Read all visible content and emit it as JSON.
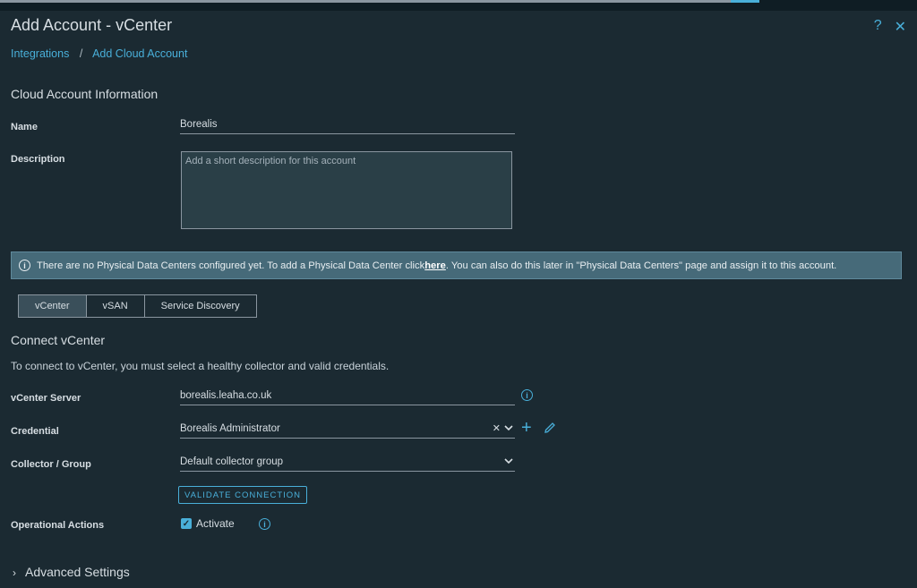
{
  "header": {
    "title": "Add Account - vCenter",
    "help_icon": "?",
    "close_icon": "✕"
  },
  "breadcrumb": {
    "items": [
      "Integrations",
      "Add Cloud Account"
    ],
    "separator": "/"
  },
  "cloud_account": {
    "section_title": "Cloud Account Information",
    "name_label": "Name",
    "name_value": "Borealis",
    "description_label": "Description",
    "description_placeholder": "Add a short description for this account"
  },
  "alert": {
    "text_before": "There are no Physical Data Centers configured yet. To add a Physical Data Center click ",
    "link": "here",
    "text_after": ". You can also do this later in \"Physical Data Centers\" page and assign it to this account."
  },
  "tabs": [
    "vCenter",
    "vSAN",
    "Service Discovery"
  ],
  "connect": {
    "title": "Connect vCenter",
    "description": "To connect to vCenter, you must select a healthy collector and valid credentials.",
    "server_label": "vCenter Server",
    "server_value": "borealis.leaha.co.uk",
    "credential_label": "Credential",
    "credential_value": "Borealis Administrator",
    "collector_label": "Collector / Group",
    "collector_value": "Default collector group",
    "validate_button": "VALIDATE CONNECTION",
    "operational_label": "Operational Actions",
    "activate_label": "Activate"
  },
  "advanced": {
    "label": "Advanced Settings"
  },
  "colors": {
    "background": "#1b2a32",
    "accent": "#49afd9",
    "alert_bg": "#466a79"
  }
}
